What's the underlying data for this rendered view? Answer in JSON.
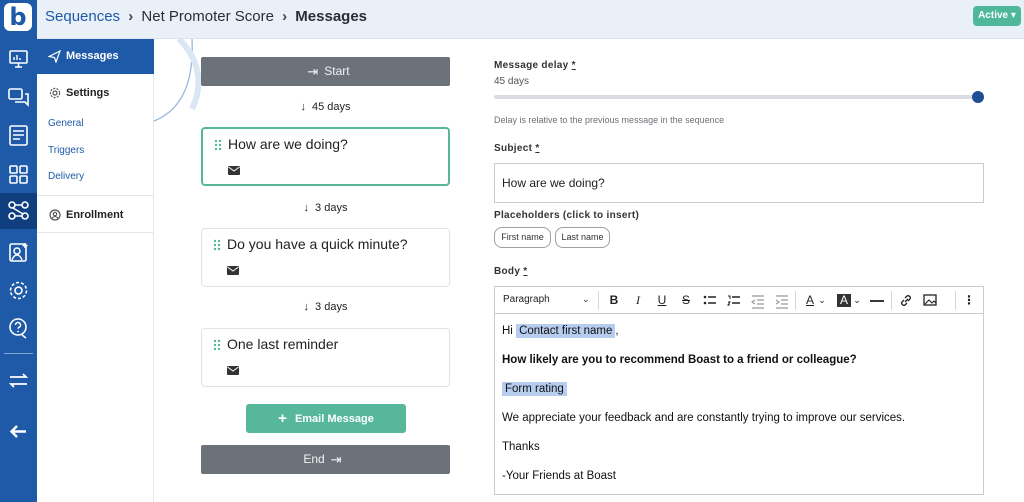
{
  "app": {
    "logo_letter": "b"
  },
  "rail": {
    "icons": [
      "dashboard-icon",
      "chat-icon",
      "forms-icon",
      "apps-icon",
      "sequences-icon",
      "contacts-icon",
      "settings-icon",
      "help-icon",
      "transfer-icon",
      "back-arrow-icon"
    ],
    "active": "sequences-icon"
  },
  "header": {
    "breadcrumb": [
      "Sequences",
      "Net Promoter Score",
      "Messages"
    ],
    "status": "Active"
  },
  "sidebar": {
    "messages": "Messages",
    "settings": "Settings",
    "settings_items": [
      "General",
      "Triggers",
      "Delivery"
    ],
    "enrollment": "Enrollment"
  },
  "sequence": {
    "start": "Start",
    "end": "End",
    "steps": [
      {
        "delay": "45 days",
        "title": "How are we doing?",
        "selected": true
      },
      {
        "delay": "3 days",
        "title": "Do you have a quick minute?"
      },
      {
        "delay": "3 days",
        "title": "One last reminder"
      }
    ],
    "add_button": "Email Message"
  },
  "form": {
    "delay_label": "Message delay",
    "delay_value": "45 days",
    "delay_hint": "Delay is relative to the previous message in the sequence",
    "delay_fraction": 1.0,
    "subject_label": "Subject",
    "subject_value": "How are we doing?",
    "placeholders_label": "Placeholders (click to insert)",
    "placeholders": [
      "First name",
      "Last name"
    ],
    "body_label": "Body",
    "required_mark": "*"
  },
  "editor": {
    "block_format": "Paragraph",
    "body": {
      "greeting": "Hi",
      "greeting_tag": "Contact first name",
      "greeting_end": ",",
      "question": "How likely are you to recommend Boast to a friend or colleague?",
      "rating_tag": "Form rating",
      "appreciation": "We appreciate your feedback and are constantly trying to improve our services.",
      "thanks": "Thanks",
      "signoff": "-Your Friends at Boast"
    }
  },
  "colors": {
    "brand": "#1e5aa8",
    "accent": "#57b79b",
    "tag": "#b6cdef"
  }
}
